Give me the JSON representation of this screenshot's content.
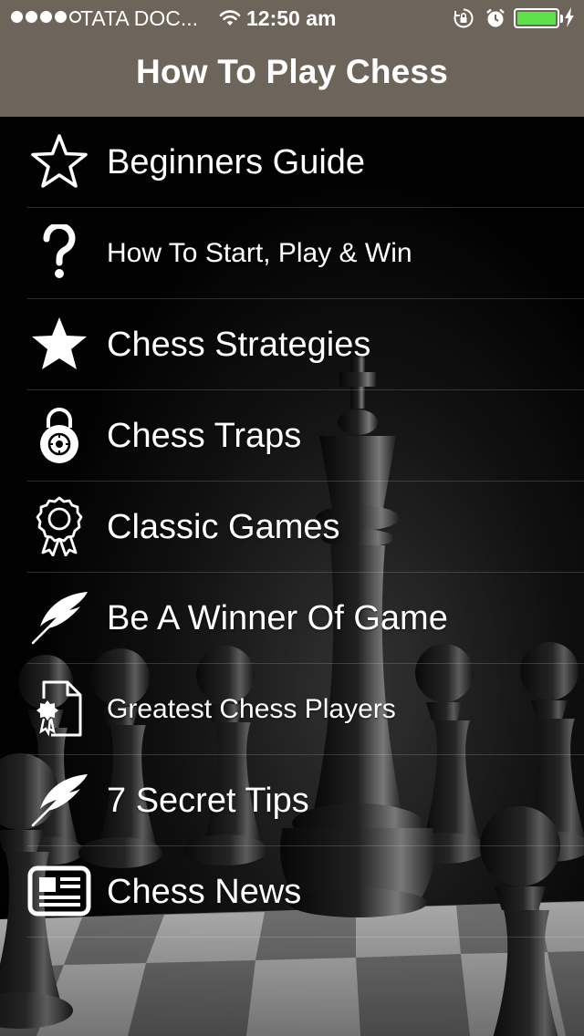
{
  "status_bar": {
    "carrier": "TATA DOC...",
    "time": "12:50 am",
    "signal_dots": [
      true,
      true,
      true,
      true,
      false
    ],
    "icons": [
      "wifi-icon",
      "rotation-lock-icon",
      "alarm-clock-icon",
      "battery-icon",
      "charging-bolt-icon"
    ],
    "battery_color": "#5ee04a"
  },
  "nav": {
    "title": "How To Play Chess",
    "background_color": "#6e655a"
  },
  "menu": {
    "items": [
      {
        "label": "Beginners Guide",
        "icon": "star-outline-icon"
      },
      {
        "label": "How To Start, Play & Win",
        "icon": "question-mark-icon"
      },
      {
        "label": "Chess Strategies",
        "icon": "star-filled-icon"
      },
      {
        "label": "Chess Traps",
        "icon": "padlock-icon"
      },
      {
        "label": "Classic Games",
        "icon": "award-badge-icon"
      },
      {
        "label": "Be A Winner Of Game",
        "icon": "feather-quill-icon"
      },
      {
        "label": "Greatest Chess Players",
        "icon": "certificate-document-icon"
      },
      {
        "label": "7 Secret Tips",
        "icon": "feather-quill-icon"
      },
      {
        "label": "Chess News",
        "icon": "newspaper-icon"
      }
    ]
  }
}
